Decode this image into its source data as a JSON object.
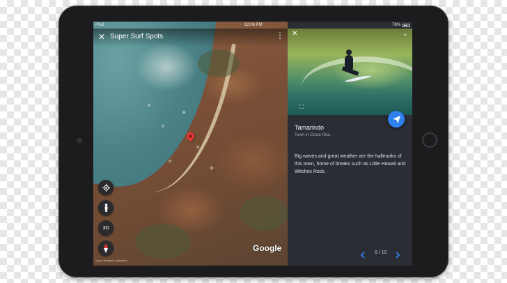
{
  "status_bar": {
    "device": "iPad",
    "time": "12:06 PM",
    "battery": "78%"
  },
  "map": {
    "title": "Super Surf Spots",
    "close_icon": "close-icon",
    "more_icon": "more-vert-icon",
    "logo": "Google",
    "attribution": "Google, TerraMetrics, DigitalGlobe",
    "controls": [
      {
        "icon": "my-location-icon"
      },
      {
        "icon": "pegman-icon"
      },
      {
        "label": "3D"
      },
      {
        "icon": "compass-icon"
      }
    ]
  },
  "place": {
    "name": "Tamarindo",
    "subtitle": "Town in Costa Rica",
    "description": "Big waves and great weather are the hallmarks of this town, home of breaks such as Little Hawaii and Witches Rock.",
    "pager": "6 / 10",
    "share_icon": "send-icon"
  },
  "colors": {
    "accent": "#2f80ed",
    "panel": "#2a2d33",
    "pin": "#e53935"
  }
}
